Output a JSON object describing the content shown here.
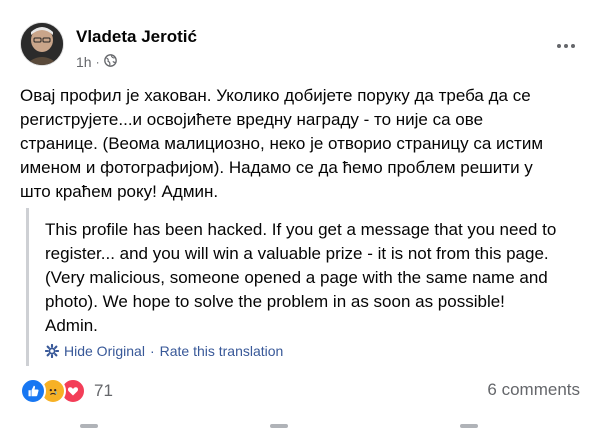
{
  "post": {
    "author": "Vladeta Jerotić",
    "time": "1h",
    "dot": "·",
    "privacy_icon": "globe-icon",
    "text": "Овај профил је хакован. Уколико добијете поруку да треба да се\nрегиструјете...и освојићете вредну награду - то није са ове\nстранице. (Веома малициозно, неко је отворио страницу са истим\nименом и фотографијом). Надамо се да ћемо проблем решити у\nшто краћем року! Админ."
  },
  "translation": {
    "text": "This profile has been hacked. If you get a message that you need to\nregister... and you will win a valuable prize - it is not from this page.\n(Very malicious, someone opened a page with the same name and\nphoto). We hope to solve the problem in as soon as possible!\nAdmin.",
    "hide_label": "Hide Original",
    "separator": "·",
    "rate_label": "Rate this translation"
  },
  "footer": {
    "reaction_icons": [
      "like-icon",
      "sad-icon",
      "love-icon"
    ],
    "reaction_count": "71",
    "comments_label": "6 comments"
  },
  "colors": {
    "link": "#385898",
    "meta": "#65676b",
    "like": "#1877f2",
    "sad": "#f7b125",
    "love": "#f33e58"
  }
}
